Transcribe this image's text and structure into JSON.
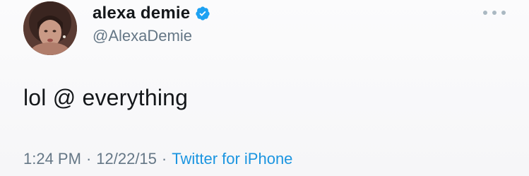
{
  "user": {
    "display_name": "alexa demie",
    "handle": "@AlexaDemie",
    "verified_icon": "verified-badge-icon",
    "avatar_icon": "profile-photo"
  },
  "tweet": {
    "text": "lol @ everything",
    "time": "1:24 PM",
    "date": "12/22/15",
    "source": "Twitter for iPhone",
    "separator": "·"
  },
  "menu": {
    "more_icon": "more-options-icon"
  },
  "colors": {
    "verified": "#1da1f2",
    "link": "#1b95e0",
    "secondary_text": "#657786",
    "primary_text": "#14171a"
  }
}
